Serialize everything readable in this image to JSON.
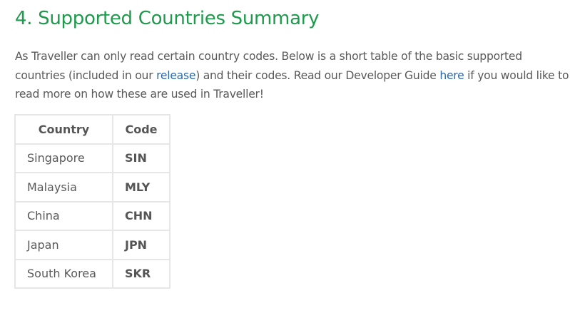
{
  "section": {
    "title": "4. Supported Countries Summary",
    "paragraph": {
      "part1": "As Traveller can only read certain country codes. Below is a short table of the basic supported countries (included in our ",
      "link_release": "release",
      "part2": ") and their codes. Read our Developer Guide ",
      "link_here": "here",
      "part3": " if you would like to read more on how these are used in Traveller!"
    }
  },
  "table": {
    "headers": {
      "country": "Country",
      "code": "Code"
    },
    "rows": [
      {
        "country": "Singapore",
        "code": "SIN"
      },
      {
        "country": "Malaysia",
        "code": "MLY"
      },
      {
        "country": "China",
        "code": "CHN"
      },
      {
        "country": "Japan",
        "code": "JPN"
      },
      {
        "country": "South Korea",
        "code": "SKR"
      }
    ]
  },
  "colors": {
    "heading": "#1e9a4c",
    "text": "#595959",
    "link": "#2a69a8",
    "table_border": "#e6e6e6"
  }
}
